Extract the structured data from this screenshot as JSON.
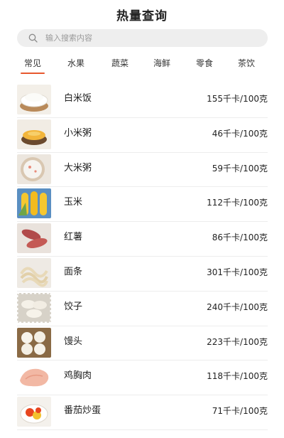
{
  "header": {
    "title": "热量查询"
  },
  "search": {
    "placeholder": "输入搜索内容",
    "icon": "search-icon"
  },
  "tabs": [
    {
      "label": "常见",
      "active": true
    },
    {
      "label": "水果",
      "active": false
    },
    {
      "label": "蔬菜",
      "active": false
    },
    {
      "label": "海鲜",
      "active": false
    },
    {
      "label": "零食",
      "active": false
    },
    {
      "label": "茶饮",
      "active": false
    }
  ],
  "accent_color": "#e7572e",
  "foods": [
    {
      "name": "白米饭",
      "calories": "155千卡/100克",
      "image": "rice-bowl-image"
    },
    {
      "name": "小米粥",
      "calories": "46千卡/100克",
      "image": "millet-porridge-image"
    },
    {
      "name": "大米粥",
      "calories": "59千卡/100克",
      "image": "rice-porridge-image"
    },
    {
      "name": "玉米",
      "calories": "112千卡/100克",
      "image": "corn-image"
    },
    {
      "name": "红薯",
      "calories": "86千卡/100克",
      "image": "sweet-potato-image"
    },
    {
      "name": "面条",
      "calories": "301千卡/100克",
      "image": "noodles-image"
    },
    {
      "name": "饺子",
      "calories": "240千卡/100克",
      "image": "dumplings-image"
    },
    {
      "name": "馒头",
      "calories": "223千卡/100克",
      "image": "steamed-buns-image"
    },
    {
      "name": "鸡胸肉",
      "calories": "118千卡/100克",
      "image": "chicken-breast-image"
    },
    {
      "name": "番茄炒蛋",
      "calories": "71千卡/100克",
      "image": "tomato-egg-image"
    }
  ]
}
